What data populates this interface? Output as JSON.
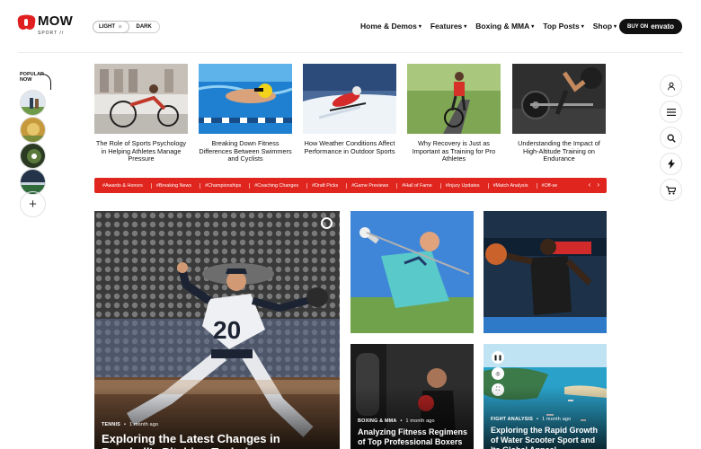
{
  "header": {
    "logo_word": "MOW",
    "logo_sub": "SPORT //",
    "mode_light": "LIGHT",
    "mode_dark": "DARK",
    "nav": [
      {
        "label": "Home & Demos"
      },
      {
        "label": "Features"
      },
      {
        "label": "Boxing & MMA"
      },
      {
        "label": "Top Posts"
      },
      {
        "label": "Shop"
      }
    ],
    "buy_prefix": "BUY ON",
    "buy_brand": "envato"
  },
  "popular": {
    "label": "POPULAR NOW",
    "add_icon": "plus-icon"
  },
  "side_icons": [
    "user-icon",
    "menu-icon",
    "search-icon",
    "lightning-icon",
    "cart-icon"
  ],
  "cards": [
    {
      "title": "The Role of Sports Psychology in Helping Athletes Manage Pressure"
    },
    {
      "title": "Breaking Down Fitness Differences Between Swimmers and Cyclists"
    },
    {
      "title": "How Weather Conditions Affect Performance in Outdoor Sports"
    },
    {
      "title": "Why Recovery is Just as Important as Training for Pro Athletes"
    },
    {
      "title": "Understanding the Impact of High-Altitude Training on Endurance"
    }
  ],
  "tags": [
    "#Awards & Honors",
    "#Breaking News",
    "#Championships",
    "#Coaching Changes",
    "#Draft Picks",
    "#Game Previews",
    "#Hall of Fame",
    "#Injury Updates",
    "#Match Analysis",
    "#Off-se"
  ],
  "posts": {
    "big": {
      "category": "TENNIS",
      "time": "1 month ago",
      "title": "Exploring the Latest Changes in Baseball's Pitching Techniques"
    },
    "boxing": {
      "category": "BOXING & MMA",
      "time": "1 month ago",
      "title": "Analyzing Fitness Regimens of Top Professional Boxers"
    },
    "fight": {
      "category": "FIGHT ANALYSIS",
      "time": "1 month ago",
      "title": "Exploring the Rapid Growth of Water Scooter Sport and Its Global Appeal"
    }
  },
  "colors": {
    "accent": "#e0241e",
    "text": "#111111"
  }
}
